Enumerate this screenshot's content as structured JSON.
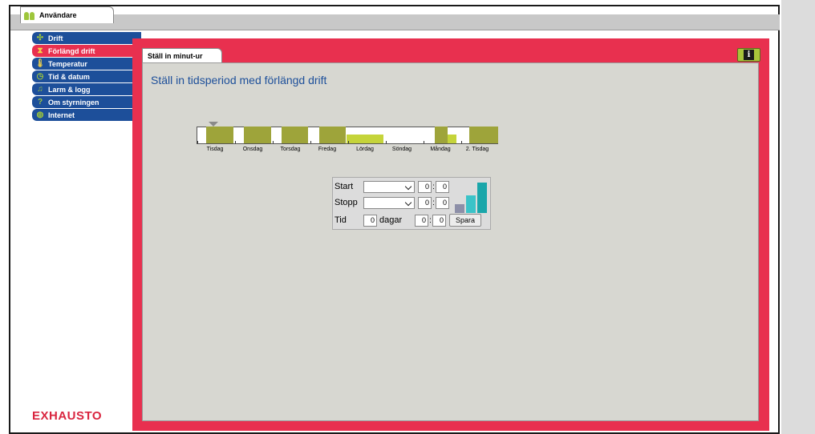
{
  "app": {
    "user_tab": "Användare",
    "brand": "EXHAUSTO"
  },
  "sidebar": {
    "items": [
      {
        "label": "Drift",
        "icon": "fan-icon",
        "active": false
      },
      {
        "label": "Förlängd drift",
        "icon": "hourglass-icon",
        "active": true
      },
      {
        "label": "Temperatur",
        "icon": "thermometer-icon",
        "active": false
      },
      {
        "label": "Tid & datum",
        "icon": "clock-icon",
        "active": false
      },
      {
        "label": "Larm & logg",
        "icon": "bell-icon",
        "active": false
      },
      {
        "label": "Om styrningen",
        "icon": "question-icon",
        "active": false
      },
      {
        "label": "Internet",
        "icon": "globe-icon",
        "active": false
      }
    ]
  },
  "main": {
    "tab_label": "Ställ in minut-ur",
    "info_label": "i",
    "heading": "Ställ in tidsperiod med förlängd drift",
    "days": [
      "Tisdag",
      "Onsdag",
      "Torsdag",
      "Fredag",
      "Lördag",
      "Söndag",
      "Måndag",
      "2. Tisdag"
    ]
  },
  "form": {
    "start_label": "Start",
    "stop_label": "Stopp",
    "time_label": "Tid",
    "start_hour": "0",
    "start_min": "0",
    "stop_hour": "0",
    "stop_min": "0",
    "days_value": "0",
    "days_label": "dagar",
    "time_hour": "0",
    "time_min": "0",
    "colon": ":",
    "save_label": "Spara"
  },
  "colors": {
    "nav_blue": "#1d4f9a",
    "accent_red": "#e8304f",
    "period_olive": "#9ea43a",
    "period_lime": "#c5d43a"
  }
}
